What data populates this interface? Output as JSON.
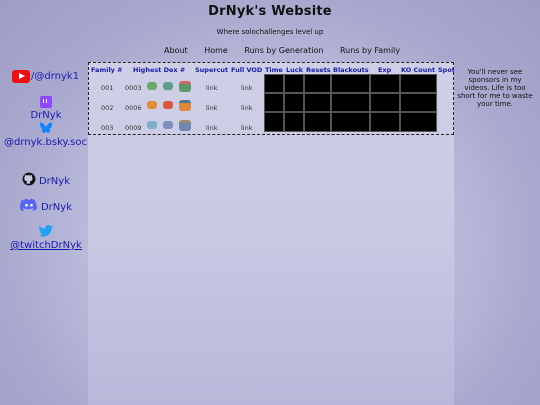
{
  "title": "DrNyk's Website",
  "subtitle": "Where solochallenges level up",
  "nav": [
    "About",
    "Home",
    "Runs by Generation",
    "Runs by Family"
  ],
  "sidebar": {
    "youtube": "/@drnyk1",
    "twitch": "DrNyk",
    "bluesky": "@drnyk.bsky.social",
    "github": "DrNyk",
    "discord": "DrNyk",
    "twitter": "@twitchDrNyk"
  },
  "table": {
    "headers": [
      "Family #",
      "Highest Dex #",
      "Supercut",
      "Full VOD",
      "Time",
      "Luck",
      "Resets",
      "Blackouts",
      "Exp",
      "KO Count",
      "Spot"
    ],
    "rows": [
      {
        "family": "001",
        "dex": "0003",
        "supercut": "link",
        "vod": "link"
      },
      {
        "family": "002",
        "dex": "0006",
        "supercut": "link",
        "vod": "link"
      },
      {
        "family": "003",
        "dex": "0009",
        "supercut": "link",
        "vod": "link"
      }
    ]
  },
  "note": "You'll never see sponsors in my videos. Life is too short for me to waste your time.",
  "icons": [
    "youtube-icon",
    "twitch-icon",
    "bluesky-icon",
    "github-icon",
    "discord-icon",
    "twitter-icon"
  ]
}
